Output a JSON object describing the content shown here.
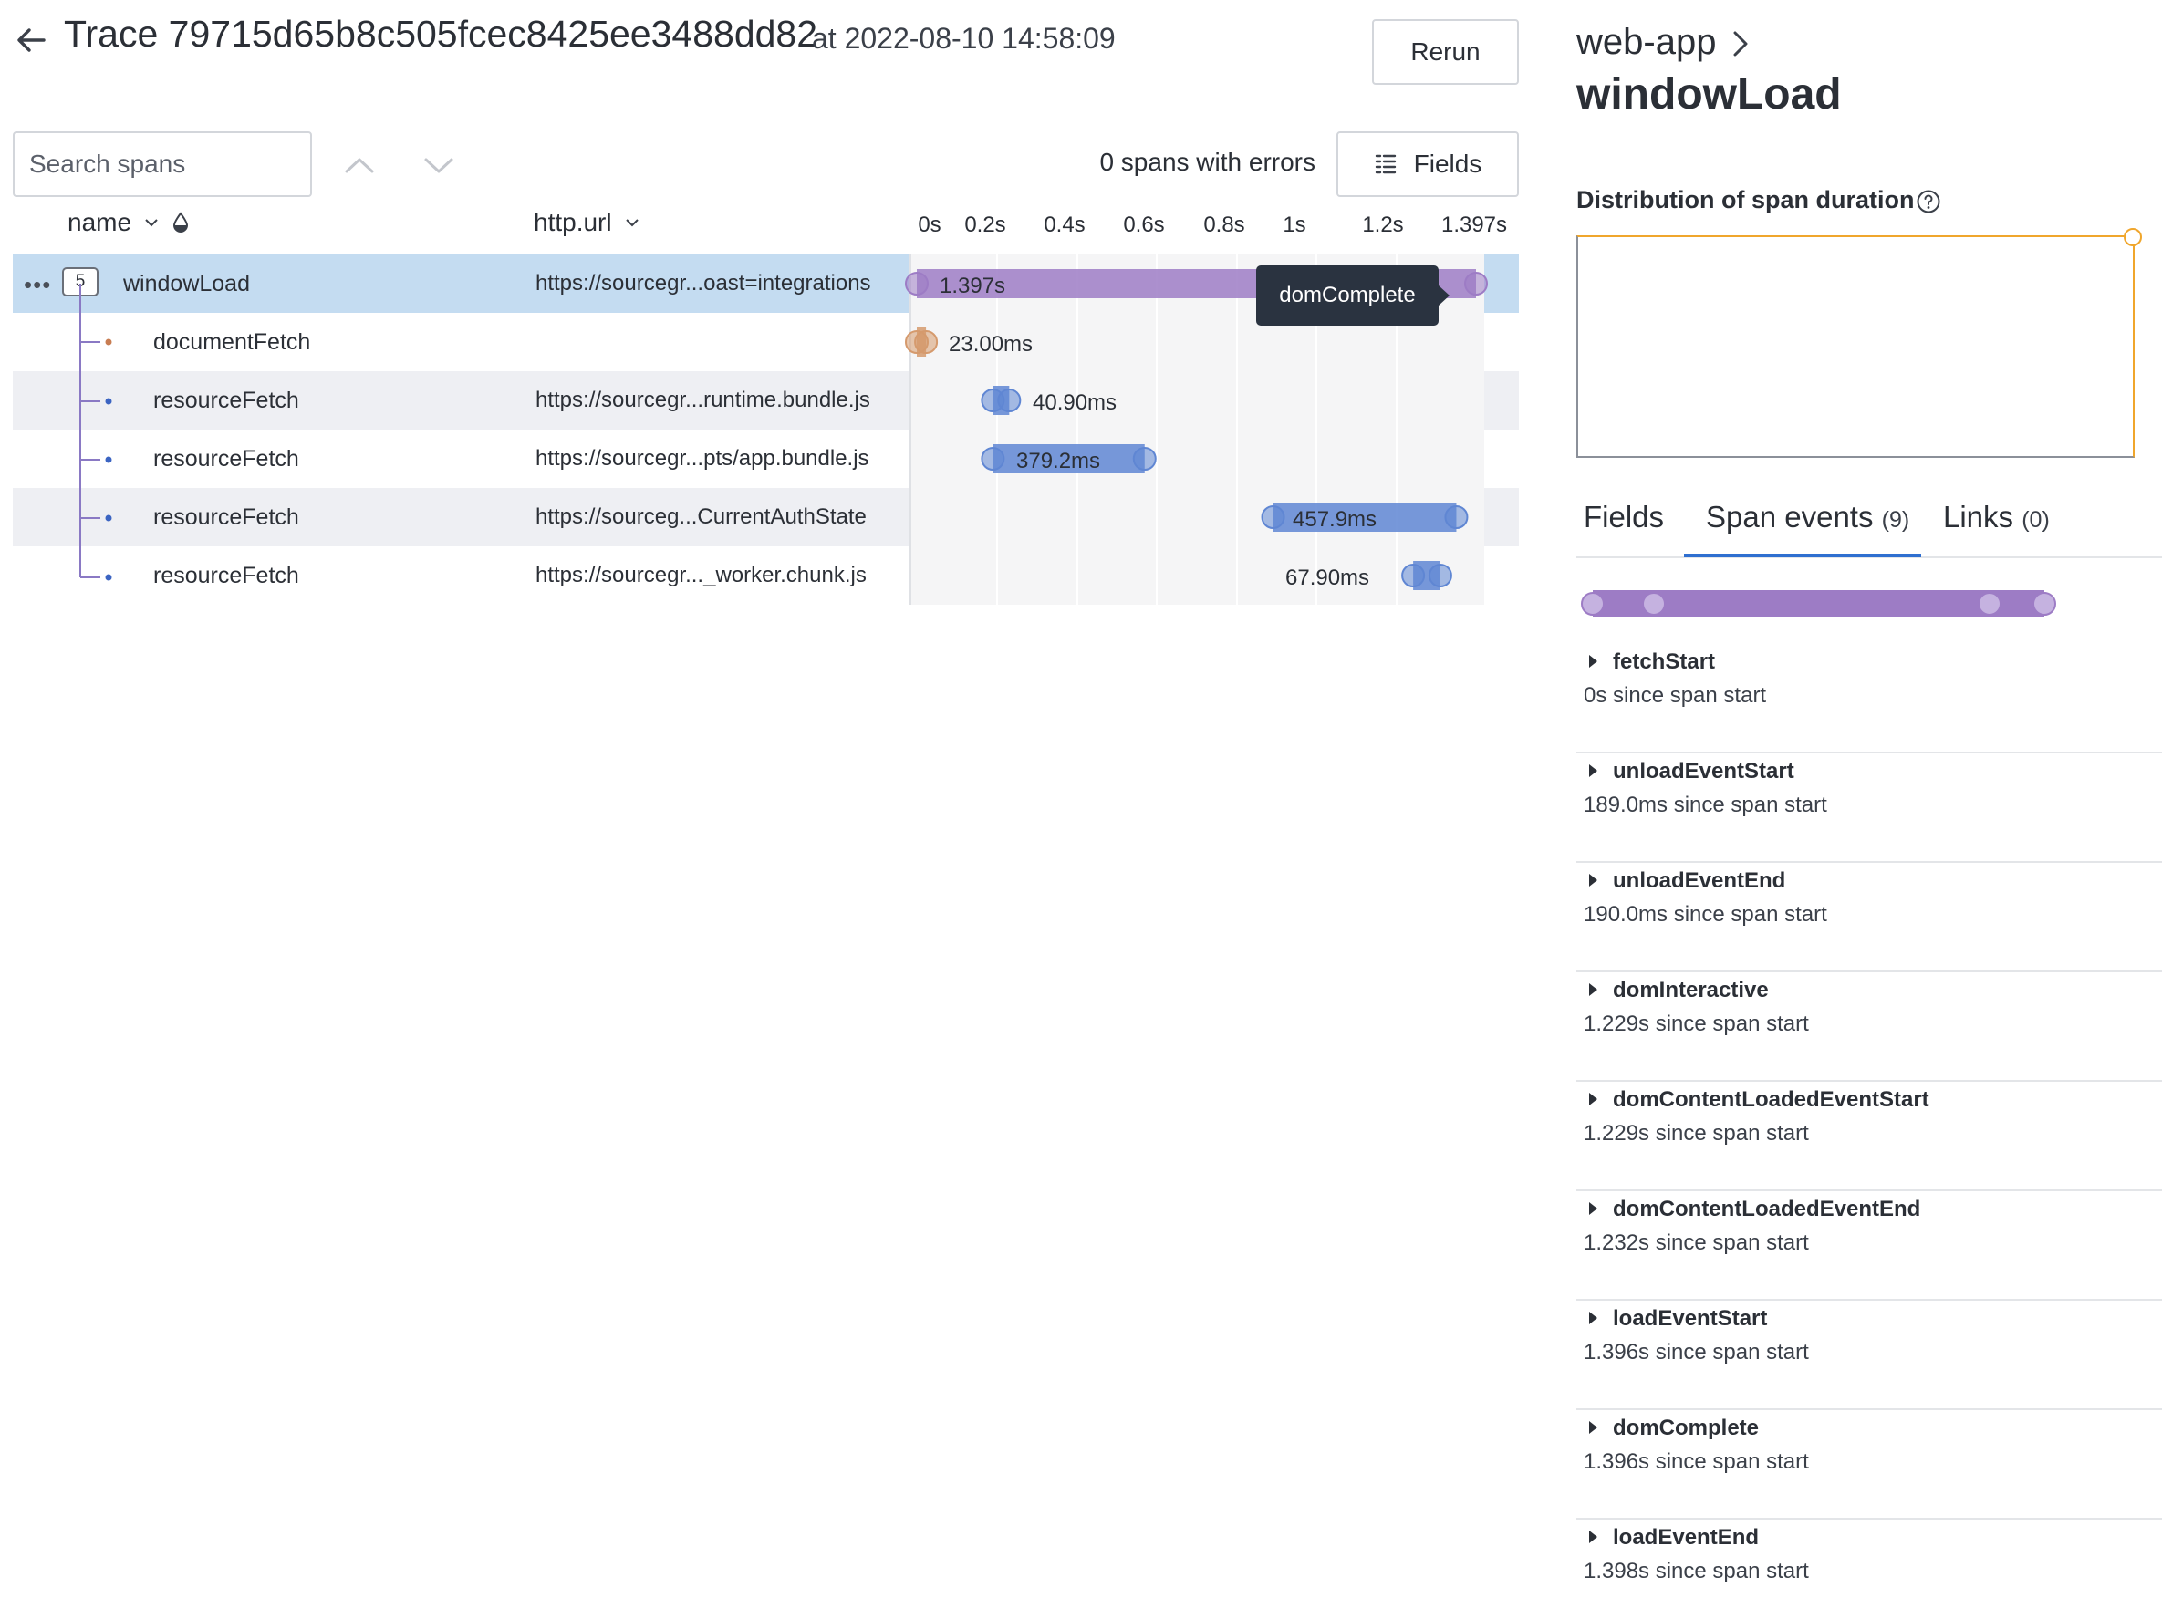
{
  "header": {
    "trace_title": "Trace 79715d65b8c505fcec8425ee3488dd82",
    "timestamp": "at 2022-08-10 14:58:09",
    "rerun_label": "Rerun"
  },
  "toolbar": {
    "search_placeholder": "Search spans",
    "errors_text": "0 spans with errors",
    "fields_label": "Fields"
  },
  "columns": {
    "name": "name",
    "url": "http.url",
    "ticks": [
      "0s",
      "0.2s",
      "0.4s",
      "0.6s",
      "0.8s",
      "1s",
      "1.2s",
      "1.397s"
    ]
  },
  "spans": [
    {
      "name": "windowLoad",
      "url": "https://sourcegr...oast=integrations",
      "duration": "1.397s",
      "children": "5",
      "start": 0,
      "end": 1.397,
      "color": "#9d7cc5"
    },
    {
      "name": "documentFetch",
      "url": "",
      "duration": "23.00ms",
      "start": 0,
      "end": 0.023,
      "color": "#d59a6d"
    },
    {
      "name": "resourceFetch",
      "url": "https://sourcegr...runtime.bundle.js",
      "duration": "40.90ms",
      "start": 0.19,
      "end": 0.2309,
      "color": "#5f86d3"
    },
    {
      "name": "resourceFetch",
      "url": "https://sourcegr...pts/app.bundle.js",
      "duration": "379.2ms",
      "start": 0.19,
      "end": 0.5692,
      "color": "#5f86d3"
    },
    {
      "name": "resourceFetch",
      "url": "https://sourceg...CurrentAuthState",
      "duration": "457.9ms",
      "start": 0.89,
      "end": 1.3479,
      "color": "#5f86d3"
    },
    {
      "name": "resourceFetch",
      "url": "https://sourcegr..._worker.chunk.js",
      "duration": "67.90ms",
      "start": 1.24,
      "end": 1.3079,
      "color": "#5f86d3"
    }
  ],
  "tooltip": "domComplete",
  "side_panel": {
    "service": "web-app",
    "span_name": "windowLoad",
    "distribution_title": "Distribution of span duration",
    "tabs": {
      "fields": "Fields",
      "events": "Span events",
      "events_count": "(9)",
      "links": "Links",
      "links_count": "(0)"
    },
    "events": [
      {
        "name": "fetchStart",
        "since": "0s since span start"
      },
      {
        "name": "unloadEventStart",
        "since": "189.0ms since span start"
      },
      {
        "name": "unloadEventEnd",
        "since": "190.0ms since span start"
      },
      {
        "name": "domInteractive",
        "since": "1.229s since span start"
      },
      {
        "name": "domContentLoadedEventStart",
        "since": "1.229s since span start"
      },
      {
        "name": "domContentLoadedEventEnd",
        "since": "1.232s since span start"
      },
      {
        "name": "loadEventStart",
        "since": "1.396s since span start"
      },
      {
        "name": "domComplete",
        "since": "1.396s since span start"
      },
      {
        "name": "loadEventEnd",
        "since": "1.398s since span start"
      }
    ]
  },
  "colors": {
    "accent": "#2f6fd0",
    "selected_row": "#c4dcf1",
    "window_load": "#9d7cc5",
    "document_fetch": "#d59a6d",
    "resource_fetch": "#5f86d3",
    "histogram_marker": "#f0a62c"
  }
}
